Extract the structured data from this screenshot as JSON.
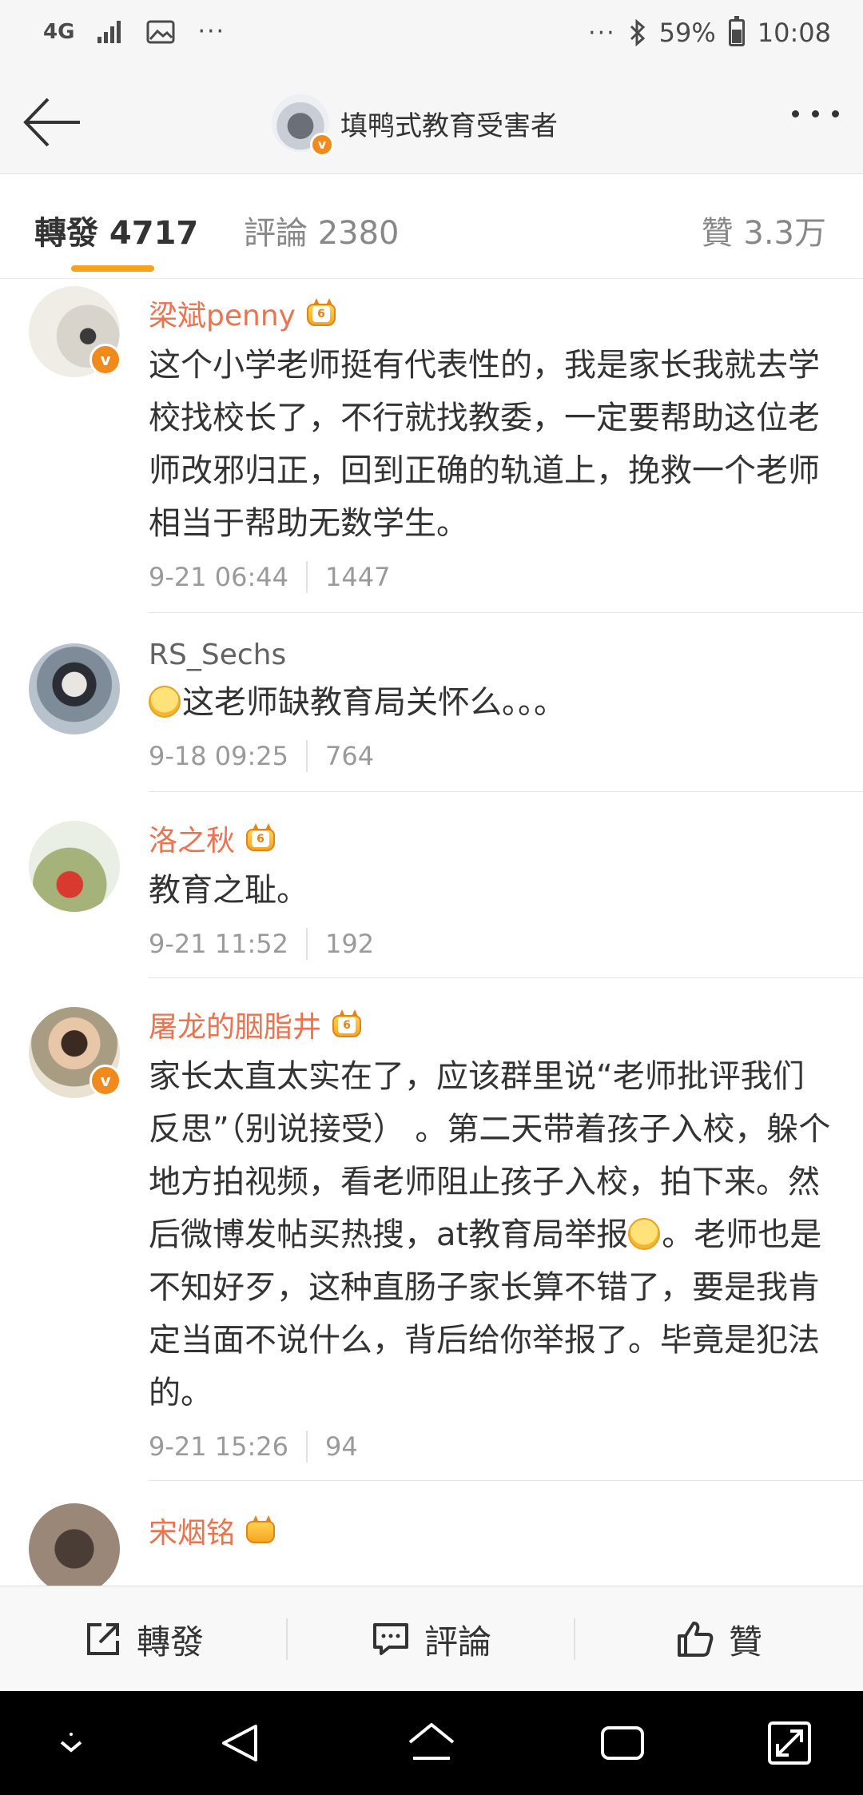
{
  "status_bar": {
    "network": "4G",
    "more": "···",
    "more_right": "···",
    "battery": "59%",
    "time": "10:08"
  },
  "nav": {
    "title": "填鸭式教育受害者",
    "back_icon": "back-arrow-icon",
    "more_icon": "more-dots-icon"
  },
  "tabs": {
    "repost": "轉發 4717",
    "comment": "評論 2380",
    "like": "贊 3.3万"
  },
  "comments": [
    {
      "user": "梁斌penny",
      "vip": true,
      "verified": true,
      "level": "6",
      "text": "这个小学老师挺有代表性的，我是家长我就去学校找校长了，不行就找教委，一定要帮助这位老师改邪归正，回到正确的轨道上，挽救一个老师相当于帮助无数学生。",
      "time": "9-21 06:44",
      "likes": "1447"
    },
    {
      "user": "RS_Sechs",
      "vip": false,
      "verified": false,
      "text": "这老师缺教育局关怀么。。。",
      "time": "9-18 09:25",
      "likes": "764"
    },
    {
      "user": "洛之秋",
      "vip": true,
      "verified": false,
      "level": "6",
      "text": "教育之耻。",
      "time": "9-21 11:52",
      "likes": "192"
    },
    {
      "user": "屠龙的胭脂井",
      "vip": true,
      "verified": true,
      "level": "6",
      "text_a": "家长太直太实在了，应该群里说“老师批评我们反思”（别说接受） 。第二天带着孩子入校，躲个地方拍视频，看老师阻止孩子入校，拍下来。然后微博发帖买热搜，at教育局举报",
      "text_b": "。老师也是不知好歹，这种直肠子家长算不错了，要是我肯定当面不说什么，背后给你举报了。毕竟是犯法的。",
      "time": "9-21 15:26",
      "likes": "94"
    }
  ],
  "partial_user": "宋烟铭",
  "bottom": {
    "repost": "轉發",
    "comment": "評論",
    "like": "贊"
  },
  "colors": {
    "accent": "#f7a21c",
    "vip_name": "#eb7350",
    "verified_badge": "#f08a1c"
  }
}
